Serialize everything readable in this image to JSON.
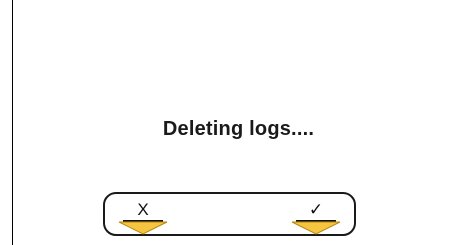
{
  "dialog": {
    "message": "Deleting logs...."
  },
  "softkeys": {
    "cancel": {
      "label": "X",
      "icon": "cancel-x-icon"
    },
    "confirm": {
      "label": "✓",
      "icon": "checkmark-icon"
    },
    "arrow_color": "#f5c542",
    "arrow_outline": "#b8860b"
  }
}
